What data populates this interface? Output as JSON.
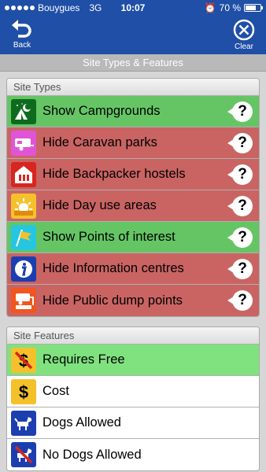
{
  "status": {
    "carrier": "Bouygues",
    "network": "3G",
    "time": "10:07",
    "battery": "70 %",
    "battery_level": 0.7
  },
  "nav": {
    "back_label": "Back",
    "clear_label": "Clear"
  },
  "page_title": "Site Types & Features",
  "site_types": {
    "header": "Site Types",
    "items": [
      {
        "label": "Show Campgrounds",
        "state": "show",
        "icon": "tent-moon-icon"
      },
      {
        "label": "Hide Caravan parks",
        "state": "hide",
        "icon": "caravan-icon"
      },
      {
        "label": "Hide Backpacker hostels",
        "state": "hide",
        "icon": "hostel-icon"
      },
      {
        "label": "Hide Day use areas",
        "state": "hide",
        "icon": "sun-icon"
      },
      {
        "label": "Show Points of interest",
        "state": "show",
        "icon": "poi-flag-icon"
      },
      {
        "label": "Hide Information centres",
        "state": "hide",
        "icon": "info-icon"
      },
      {
        "label": "Hide Public dump points",
        "state": "hide",
        "icon": "dump-point-icon"
      }
    ],
    "help_glyph": "?"
  },
  "site_features": {
    "header": "Site Features",
    "items": [
      {
        "label": "Requires Free",
        "state": "require",
        "icon": "no-cost-icon"
      },
      {
        "label": "Cost",
        "state": "plain",
        "icon": "dollar-icon"
      },
      {
        "label": "Dogs Allowed",
        "state": "plain",
        "icon": "dog-icon"
      },
      {
        "label": "No Dogs Allowed",
        "state": "plain",
        "icon": "no-dog-icon"
      }
    ]
  },
  "colors": {
    "nav_blue": "#1f4fa6",
    "show_green": "#65c565",
    "hide_red": "#c96463",
    "require_green": "#7fe27f"
  }
}
